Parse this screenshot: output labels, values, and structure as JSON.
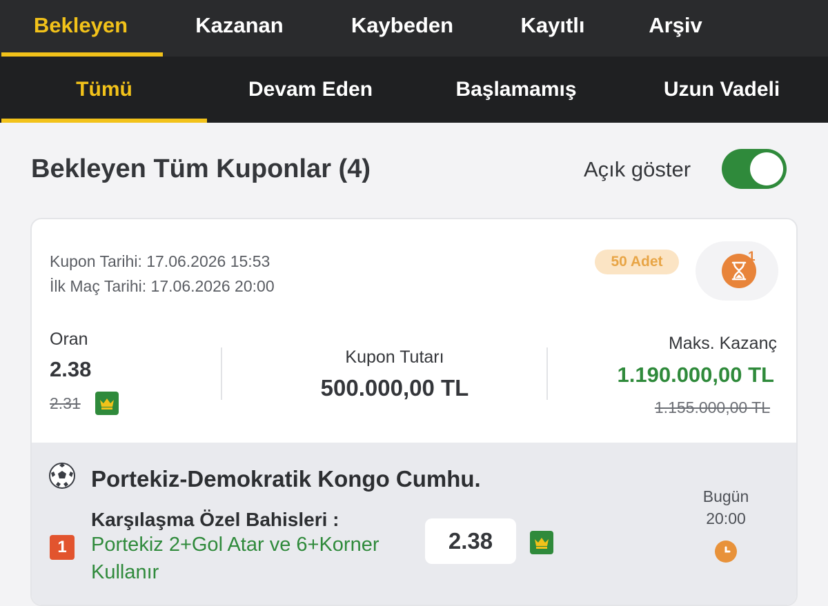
{
  "top_tabs": [
    {
      "label": "Bekleyen",
      "active": true
    },
    {
      "label": "Kazanan",
      "active": false
    },
    {
      "label": "Kaybeden",
      "active": false
    },
    {
      "label": "Kayıtlı",
      "active": false
    },
    {
      "label": "Arşiv",
      "active": false
    }
  ],
  "sub_tabs": [
    {
      "label": "Tümü",
      "active": true
    },
    {
      "label": "Devam Eden",
      "active": false
    },
    {
      "label": "Başlamamış",
      "active": false
    },
    {
      "label": "Uzun Vadeli",
      "active": false
    }
  ],
  "header": {
    "title": "Bekleyen Tüm Kuponlar (4)",
    "toggle_label": "Açık göster",
    "toggle_on": true
  },
  "coupon": {
    "kupon_tarihi": "Kupon Tarihi: 17.06.2026 15:53",
    "ilk_mac_tarihi": "İlk Maç Tarihi: 17.06.2026 20:00",
    "adet_badge": "50 Adet",
    "pending_count": "1",
    "oran_label": "Oran",
    "oran_value": "2.38",
    "oran_old": "2.31",
    "tutar_label": "Kupon Tutarı",
    "tutar_value": "500.000,00 TL",
    "kazanc_label": "Maks. Kazanç",
    "kazanc_value": "1.190.000,00 TL",
    "kazanc_old": "1.155.000,00 TL"
  },
  "match": {
    "title": "Portekiz-Demokratik Kongo Cumhu.",
    "market": "Karşılaşma Özel Bahisleri :",
    "selection_number": "1",
    "selection": "Portekiz 2+Gol Atar ve 6+Korner Kullanır",
    "odd": "2.38",
    "day": "Bugün",
    "time": "20:00"
  },
  "colors": {
    "accent_yellow": "#f2c21a",
    "green": "#2f8a3b",
    "orange": "#e8843a",
    "dark_bar": "#2a2b2d"
  },
  "icons": [
    "hourglass-icon",
    "crown-icon",
    "soccer-ball-icon",
    "clock-icon"
  ]
}
